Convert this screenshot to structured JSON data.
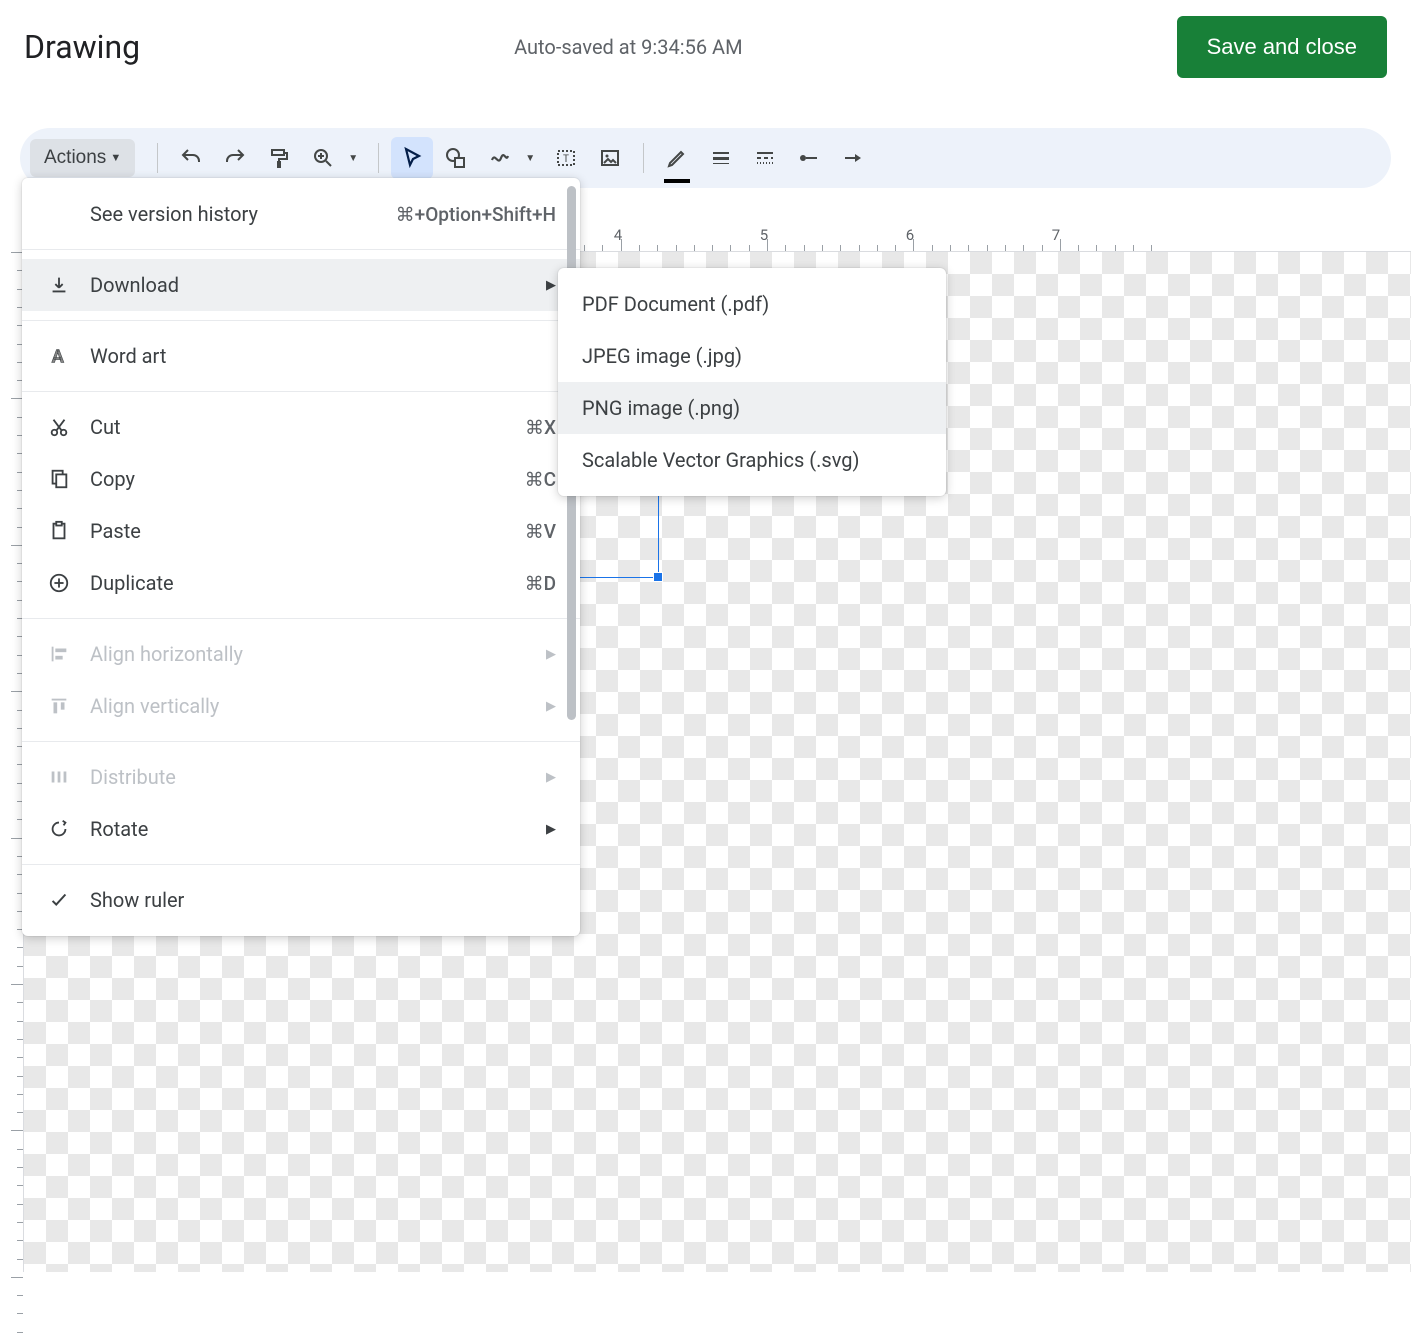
{
  "header": {
    "title": "Drawing",
    "autosave": "Auto-saved at 9:34:56 AM",
    "save_button": "Save and close"
  },
  "toolbar": {
    "actions_label": "Actions"
  },
  "ruler": {
    "marks": [
      "4",
      "5",
      "6",
      "7"
    ]
  },
  "actions_menu": {
    "items": [
      {
        "label": "See version history",
        "shortcut": "⌘+Option+Shift+H",
        "has_submenu": false
      },
      {
        "label": "Download",
        "has_submenu": true
      },
      {
        "label": "Word art",
        "has_submenu": false
      },
      {
        "label": "Cut",
        "shortcut": "⌘X"
      },
      {
        "label": "Copy",
        "shortcut": "⌘C"
      },
      {
        "label": "Paste",
        "shortcut": "⌘V"
      },
      {
        "label": "Duplicate",
        "shortcut": "⌘D"
      },
      {
        "label": "Align horizontally",
        "has_submenu": true,
        "disabled": true
      },
      {
        "label": "Align vertically",
        "has_submenu": true,
        "disabled": true
      },
      {
        "label": "Distribute",
        "has_submenu": true,
        "disabled": true
      },
      {
        "label": "Rotate",
        "has_submenu": true
      },
      {
        "label": "Show ruler"
      }
    ]
  },
  "download_submenu": {
    "items": [
      {
        "label": "PDF Document (.pdf)"
      },
      {
        "label": "JPEG image (.jpg)"
      },
      {
        "label": "PNG image (.png)"
      },
      {
        "label": "Scalable Vector Graphics (.svg)"
      }
    ]
  }
}
